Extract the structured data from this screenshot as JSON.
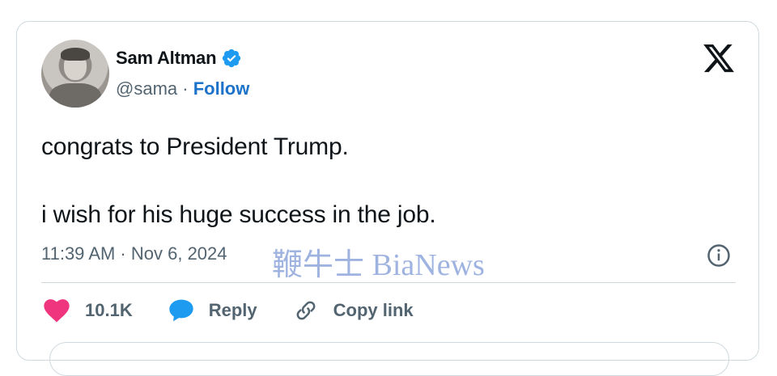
{
  "author": {
    "name": "Sam Altman",
    "handle": "@sama",
    "separator": " · ",
    "follow_label": "Follow",
    "verified_icon": "verified-badge-icon"
  },
  "tweet": {
    "line1": "congrats to President Trump.",
    "line2": "i wish for his huge success in the job.",
    "timestamp": "11:39 AM · Nov 6, 2024"
  },
  "actions": {
    "likes": "10.1K",
    "reply_label": "Reply",
    "copy_label": "Copy link"
  },
  "watermark": "鞭牛士 BiaNews",
  "colors": {
    "accent": "#1d72c9",
    "like": "#f0357f",
    "reply": "#1d9bf0",
    "verified": "#1d9bf0",
    "text": "#0f1419",
    "muted": "#536471"
  }
}
